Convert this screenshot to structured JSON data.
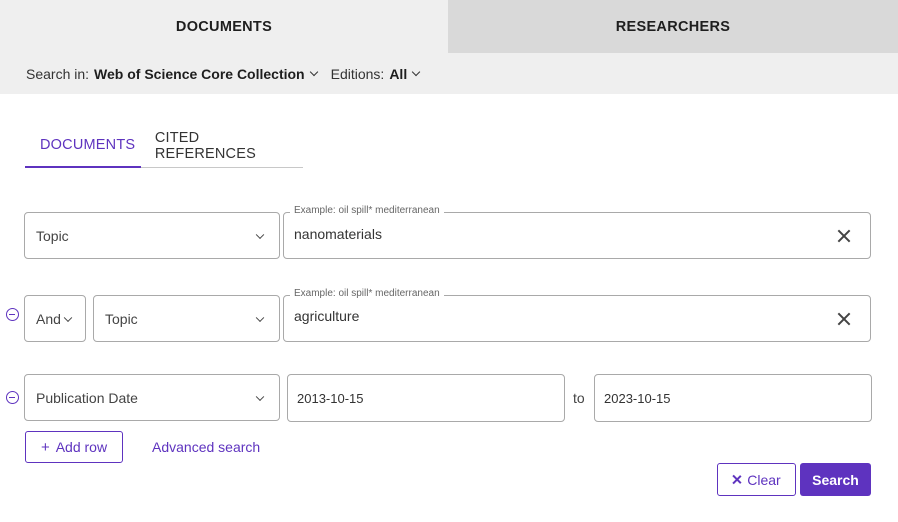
{
  "top_tabs": {
    "documents": "DOCUMENTS",
    "researchers": "RESEARCHERS"
  },
  "search_in": {
    "label": "Search in:",
    "collection": "Web of Science Core Collection",
    "editions_label": "Editions:",
    "editions_value": "All"
  },
  "sub_tabs": {
    "documents": "DOCUMENTS",
    "cited_references": "CITED REFERENCES"
  },
  "rows": [
    {
      "field": "Topic",
      "placeholder": "Example: oil spill* mediterranean",
      "value": "nanomaterials"
    },
    {
      "operator": "And",
      "field": "Topic",
      "placeholder": "Example: oil spill* mediterranean",
      "value": "agriculture"
    },
    {
      "field": "Publication Date",
      "date_from": "2013-10-15",
      "to_label": "to",
      "date_to": "2023-10-15"
    }
  ],
  "actions": {
    "add_row": "Add row",
    "add_row_icon": "+",
    "advanced_search": "Advanced search",
    "clear": "Clear",
    "search": "Search"
  },
  "colors": {
    "accent": "#5e33bf",
    "tab_bar": "#efefef",
    "tab_inactive": "#d9d9d9"
  }
}
